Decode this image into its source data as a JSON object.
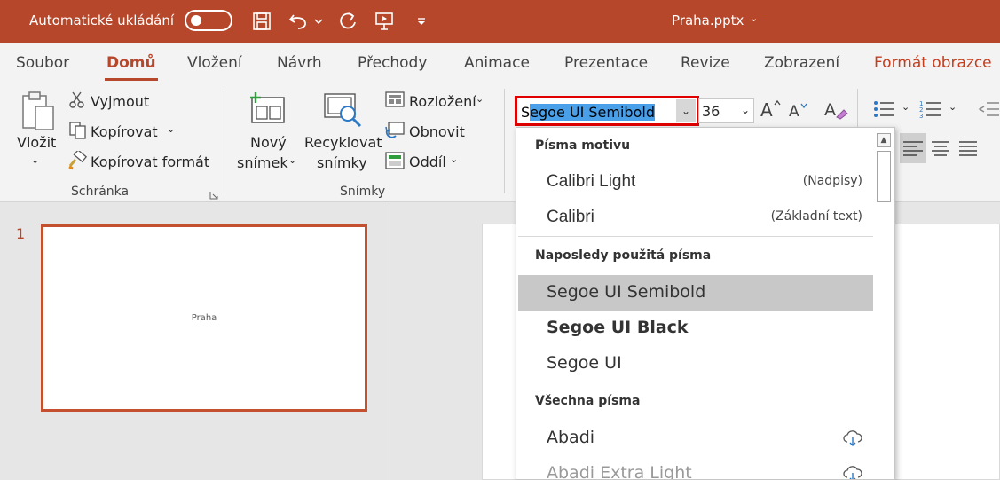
{
  "titlebar": {
    "autosave_label": "Automatické ukládání",
    "document_title": "Praha.pptx",
    "title_caret": "⌄"
  },
  "tabs": [
    {
      "label": "Soubor"
    },
    {
      "label": "Domů"
    },
    {
      "label": "Vložení"
    },
    {
      "label": "Návrh"
    },
    {
      "label": "Přechody"
    },
    {
      "label": "Animace"
    },
    {
      "label": "Prezentace"
    },
    {
      "label": "Revize"
    },
    {
      "label": "Zobrazení"
    },
    {
      "label": "Formát obrazce"
    }
  ],
  "ribbon": {
    "clipboard": {
      "paste": "Vložit",
      "cut": "Vyjmout",
      "copy": "Kopírovat",
      "format_painter": "Kopírovat formát",
      "group_label": "Schránka"
    },
    "slides": {
      "new_slide_line1": "Nový",
      "new_slide_line2": "snímek",
      "reuse_line1": "Recyklovat",
      "reuse_line2": "snímky",
      "layout": "Rozložení",
      "reset": "Obnovit",
      "section": "Oddíl",
      "group_label": "Snímky"
    },
    "font": {
      "name_prefix": "S",
      "name_selected": "egoe UI Semibold",
      "size": "36"
    }
  },
  "font_dropdown": {
    "theme_header": "Písma motivu",
    "theme_fonts": [
      {
        "name": "Calibri Light",
        "hint": "(Nadpisy)"
      },
      {
        "name": "Calibri",
        "hint": "(Základní text)"
      }
    ],
    "recent_header": "Naposledy použitá písma",
    "recent_fonts": [
      {
        "name": "Segoe UI Semibold"
      },
      {
        "name": "Segoe UI Black"
      },
      {
        "name": "Segoe UI"
      }
    ],
    "all_header": "Všechna písma",
    "all_fonts": [
      {
        "name": "Abadi"
      },
      {
        "name": "Abadi Extra Light"
      }
    ]
  },
  "slides_pane": {
    "slide_number": "1",
    "slide_title": "Praha"
  },
  "colors": {
    "accent": "#b7472a",
    "selection": "#4aa0e8",
    "highlight_border": "#e00000"
  }
}
